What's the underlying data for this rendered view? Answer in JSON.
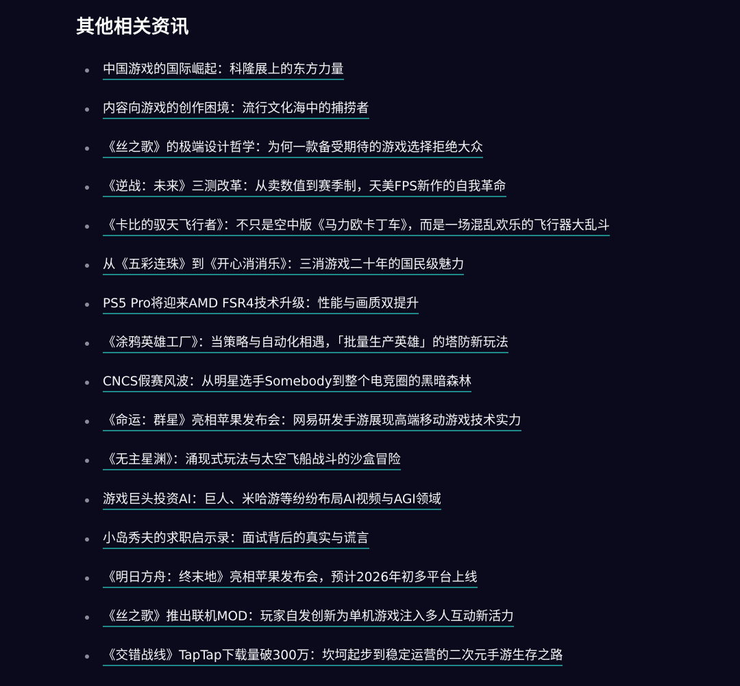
{
  "section": {
    "title": "其他相关资讯",
    "items": [
      {
        "label": "中国游戏的国际崛起：科隆展上的东方力量"
      },
      {
        "label": "内容向游戏的创作困境：流行文化海中的捕捞者"
      },
      {
        "label": "《丝之歌》的极端设计哲学：为何一款备受期待的游戏选择拒绝大众"
      },
      {
        "label": "《逆战：未来》三测改革：从卖数值到赛季制，天美FPS新作的自我革命"
      },
      {
        "label": "《卡比的驭天飞行者》：不只是空中版《马力欧卡丁车》，而是一场混乱欢乐的飞行器大乱斗"
      },
      {
        "label": "从《五彩连珠》到《开心消消乐》：三消游戏二十年的国民级魅力"
      },
      {
        "label": "PS5 Pro将迎来AMD FSR4技术升级：性能与画质双提升"
      },
      {
        "label": "《涂鸦英雄工厂》：当策略与自动化相遇，「批量生产英雄」的塔防新玩法"
      },
      {
        "label": "CNCS假赛风波：从明星选手Somebody到整个电竞圈的黑暗森林"
      },
      {
        "label": "《命运：群星》亮相苹果发布会：网易研发手游展现高端移动游戏技术实力"
      },
      {
        "label": "《无主星渊》：涌现式玩法与太空飞船战斗的沙盒冒险"
      },
      {
        "label": "游戏巨头投资AI：巨人、米哈游等纷纷布局AI视频与AGI领域"
      },
      {
        "label": "小岛秀夫的求职启示录：面试背后的真实与谎言"
      },
      {
        "label": "《明日方舟：终末地》亮相苹果发布会，预计2026年初多平台上线"
      },
      {
        "label": "《丝之歌》推出联机MOD：玩家自发创新为单机游戏注入多人互动新活力"
      },
      {
        "label": "《交错战线》TapTap下载量破300万：坎坷起步到稳定运营的二次元手游生存之路"
      }
    ]
  },
  "colors": {
    "background": "#0b0a1c",
    "text": "#f4f4f7",
    "link_underline": "#1e8a8a",
    "bullet": "#8a8d99"
  }
}
